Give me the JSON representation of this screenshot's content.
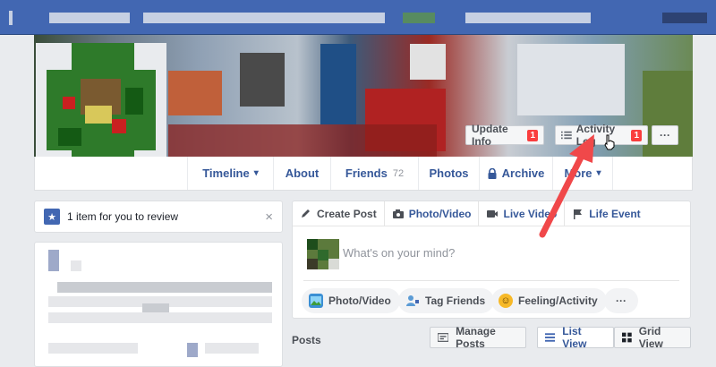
{
  "cover_actions": {
    "update_info": {
      "label": "Update Info",
      "badge": "1"
    },
    "activity_log": {
      "label": "Activity Log",
      "badge": "1"
    },
    "more": "···"
  },
  "tabs": [
    {
      "label": "Timeline",
      "caret": "▾"
    },
    {
      "label": "About"
    },
    {
      "label": "Friends",
      "count": "72"
    },
    {
      "label": "Photos"
    },
    {
      "label": "Archive",
      "icon": "lock-icon"
    },
    {
      "label": "More",
      "caret": "▾"
    }
  ],
  "review": {
    "text": "1 item for you to review",
    "close": "×"
  },
  "composer": {
    "tabs": [
      "Create Post",
      "Photo/Video",
      "Live Video",
      "Life Event"
    ],
    "placeholder": "What's on your mind?",
    "actions": [
      "Photo/Video",
      "Tag Friends",
      "Feeling/Activity"
    ],
    "more": "···"
  },
  "posts": {
    "heading": "Posts",
    "manage": "Manage Posts",
    "list_view": "List View",
    "grid_view": "Grid View"
  },
  "colors": {
    "brand": "#4267b2",
    "link": "#365899",
    "badge": "#fa3e3e",
    "arrow": "#f0484a"
  }
}
